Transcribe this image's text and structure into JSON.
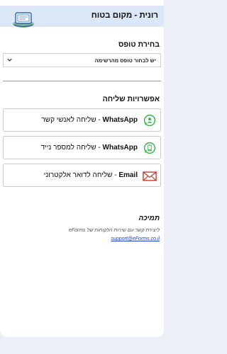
{
  "header": {
    "title": "רונית - מקום בטוח"
  },
  "form_select": {
    "title": "בחירת טופס",
    "selected": "יש לבחור טופס מהרשימה"
  },
  "send_options": {
    "title": "אפשרויות שליחה",
    "items": [
      {
        "brand": "WhatsApp",
        "text": " - שליחה לאנשי קשר",
        "icon": "whatsapp-contacts-icon"
      },
      {
        "brand": "WhatsApp",
        "text": " - שליחה למספר נייד",
        "icon": "whatsapp-mobile-icon"
      },
      {
        "brand": "Email",
        "text": " - שליחה לדואר אלקטרוני",
        "icon": "envelope-icon"
      }
    ]
  },
  "support": {
    "title": "תמיכה",
    "line": "ליצירת קשר עם שירות הלקוחות של eForms",
    "email": "support@eForms.co.il"
  },
  "colors": {
    "header_bg": "#dbe6f7",
    "whatsapp_green": "#36b54a",
    "envelope_red": "#c0392b",
    "link_blue": "#1f3fb6"
  }
}
